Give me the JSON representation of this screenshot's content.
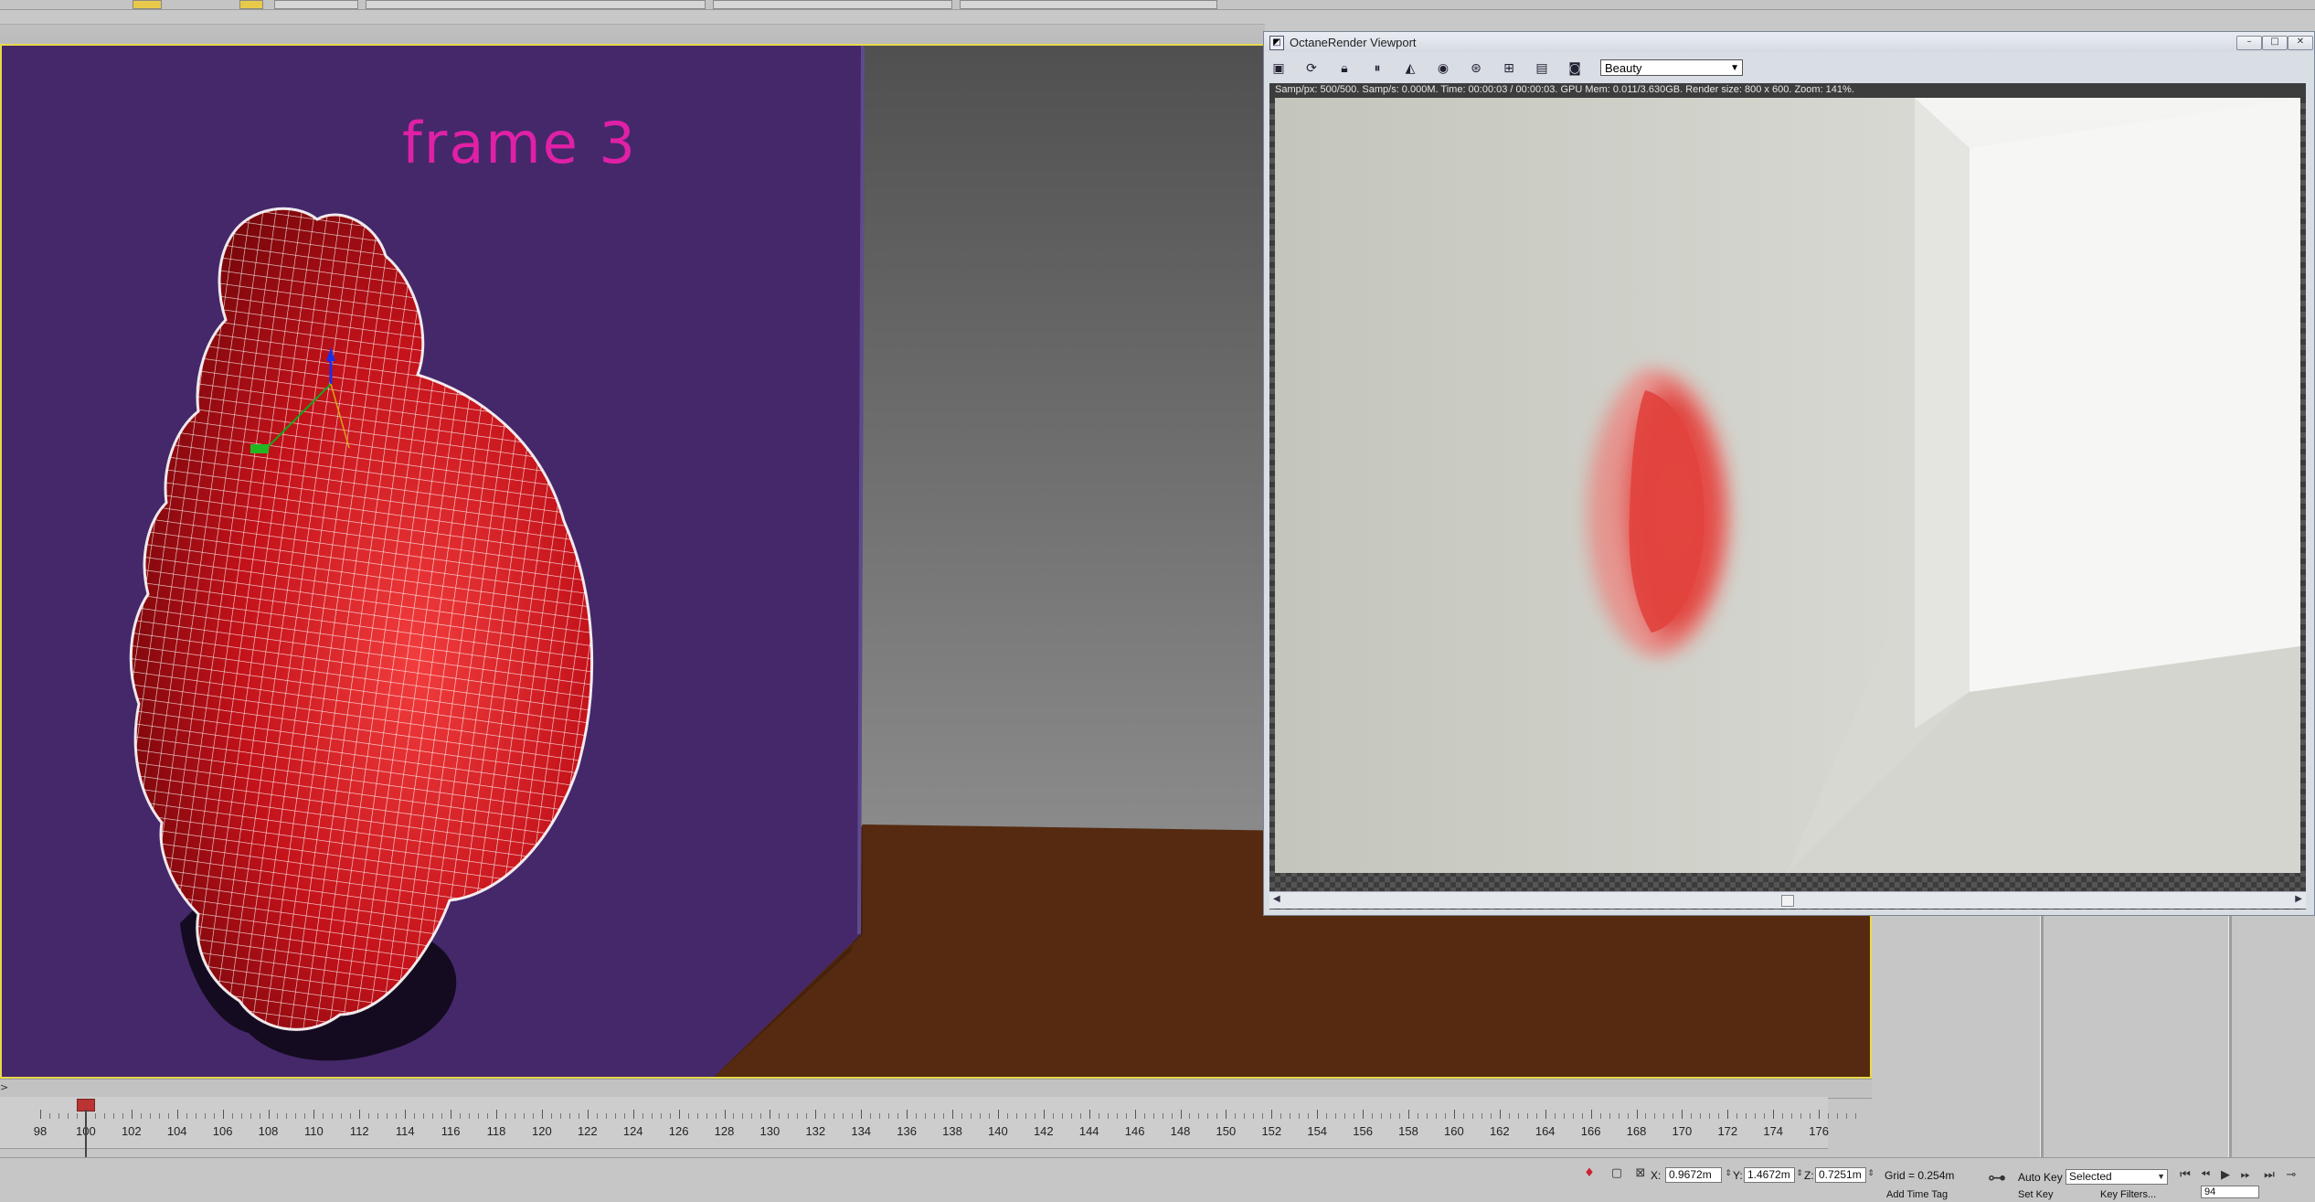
{
  "viewport": {
    "overlay_label": "frame 3"
  },
  "octane_window": {
    "title": "OctaneRender Viewport",
    "render_pass": "Beauty",
    "stats": "Samp/px: 500/500.   Samp/s: 0.000M.   Time: 00:00:03 / 00:00:03.   GPU Mem: 0.011/3.630GB.   Render size: 800 x 600.   Zoom: 141%.",
    "window_buttons": {
      "minimize": "–",
      "maximize": "□",
      "close": "✕"
    },
    "toolbar_icons": [
      "export-icon",
      "refresh-icon",
      "lock-icon",
      "pause-icon",
      "stats-icon",
      "color-picker-icon",
      "focus-icon",
      "region-icon",
      "save-icon",
      "camera-icon"
    ]
  },
  "timeline": {
    "expand_glyph": ">",
    "current_frame": 100,
    "ticks": [
      "98",
      "100",
      "102",
      "104",
      "106",
      "108",
      "110",
      "112",
      "114",
      "116",
      "118",
      "120",
      "122",
      "124",
      "126",
      "128",
      "130",
      "132",
      "134",
      "136",
      "138",
      "140",
      "142",
      "144",
      "146",
      "148",
      "150",
      "152",
      "154",
      "156",
      "158",
      "160",
      "162",
      "164",
      "166",
      "168",
      "170",
      "172",
      "174",
      "176"
    ]
  },
  "status_bar": {
    "x_label": "X:",
    "x_value": "0.9672m",
    "y_label": "Y:",
    "y_value": "1.4672m",
    "z_label": "Z:",
    "z_value": "0.7251m",
    "grid": "Grid = 0.254m",
    "auto_key": "Auto Key",
    "set_key": "Set Key",
    "selected": "Selected",
    "key_filters": "Key Filters...",
    "frame_field": "94",
    "add_time_tag": "Add Time Tag"
  },
  "colors": {
    "viewport_border": "#e8d94a",
    "wall_purple": "#45286a",
    "floor_brown": "#552a10",
    "mesh_red": "#c3121a",
    "frame_label": "#e020a6"
  }
}
